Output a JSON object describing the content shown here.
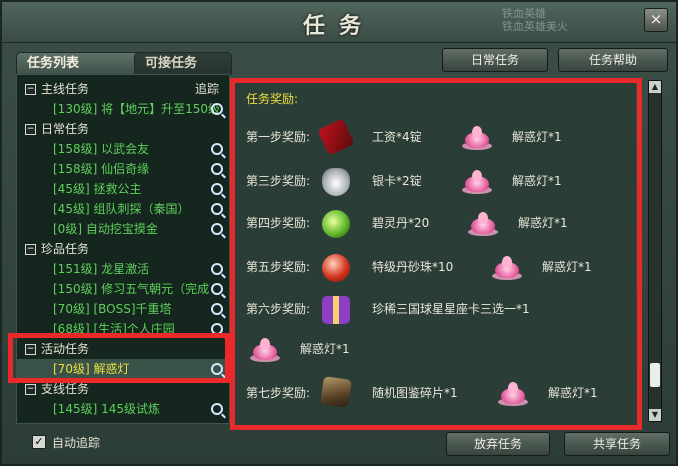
{
  "window": {
    "title": "任务",
    "watermark_line1": "铁血英雄",
    "watermark_line2": "铁血英雄美火",
    "close_symbol": "×"
  },
  "tabs": [
    "任务列表",
    "可接任务"
  ],
  "top_buttons": {
    "daily": "日常任务",
    "help": "任务帮助"
  },
  "left_panel": {
    "track_label": "追踪",
    "groups": [
      {
        "name": "主线任务",
        "items": [
          "[130级] 将【地元】升至150级"
        ]
      },
      {
        "name": "日常任务",
        "items": [
          "[158级] 以武会友",
          "[158级] 仙侣奇缘",
          "[45级] 拯救公主",
          "[45级] 组队刺探（秦国）",
          "[0级] 自动挖宝摸金"
        ]
      },
      {
        "name": "珍品任务",
        "items": [
          "[151级] 龙星激活",
          "[150级] 修习五气朝元（完成",
          "[70级] [BOSS]千重塔",
          "[68级] [生活]个人庄园"
        ]
      },
      {
        "name": "活动任务",
        "items": [
          "[70级] 解惑灯"
        ]
      },
      {
        "name": "支线任务",
        "items": [
          "[145级] 145级试炼"
        ]
      }
    ],
    "expand_symbol": "−"
  },
  "right_panel": {
    "title": "任务奖励:",
    "rows": [
      {
        "label": "第一步奖励:",
        "reward1": "工资*4锭",
        "reward2": "解惑灯*1"
      },
      {
        "label": "第三步奖励:",
        "reward1": "银卡*2锭",
        "reward2": "解惑灯*1"
      },
      {
        "label": "第四步奖励:",
        "reward1": "碧灵丹*20",
        "reward2": "解惑灯*1"
      },
      {
        "label": "第五步奖励:",
        "reward1": "特级丹砂珠*10",
        "reward2": "解惑灯*1"
      },
      {
        "label": "第六步奖励:",
        "reward1": "珍稀三国球星星座卡三选一*1",
        "reward2": "解惑灯*1"
      },
      {
        "label": "第七步奖励:",
        "reward1": "随机图鉴碎片*1",
        "reward2": "解惑灯*1"
      }
    ]
  },
  "bottom": {
    "auto_track": "自动追踪",
    "check_symbol": "✓",
    "abandon": "放弃任务",
    "share": "共享任务"
  },
  "colors": {
    "quest_green": "#5ed05a",
    "reward_title": "#e8e03e",
    "highlight_red": "#ea2a2a"
  }
}
